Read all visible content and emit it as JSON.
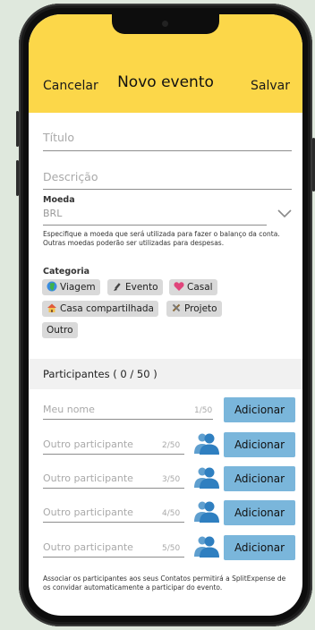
{
  "header": {
    "cancel_label": "Cancelar",
    "title": "Novo evento",
    "save_label": "Salvar",
    "bg_color": "#fcd749"
  },
  "form": {
    "title_placeholder": "Título",
    "description_placeholder": "Descrição",
    "currency_label": "Moeda",
    "currency_value": "BRL",
    "currency_help": "Especifique a moeda que será utilizada para fazer o balanço da conta. Outras moedas poderão ser utilizadas para despesas.",
    "category_label": "Categoria",
    "categories": [
      {
        "label": "Viagem",
        "icon": "globe-icon"
      },
      {
        "label": "Evento",
        "icon": "brush-icon"
      },
      {
        "label": "Casal",
        "icon": "heart-icon"
      },
      {
        "label": "Casa compartilhada",
        "icon": "house-icon"
      },
      {
        "label": "Projeto",
        "icon": "tools-icon"
      },
      {
        "label": "Outro",
        "icon": ""
      }
    ]
  },
  "participants": {
    "section_title": "Participantes ( 0 / 50 )",
    "rows": [
      {
        "placeholder": "Meu nome",
        "count": "1/50",
        "button": "Adicionar",
        "has_contact_icon": false
      },
      {
        "placeholder": "Outro participante",
        "count": "2/50",
        "button": "Adicionar",
        "has_contact_icon": true
      },
      {
        "placeholder": "Outro participante",
        "count": "3/50",
        "button": "Adicionar",
        "has_contact_icon": true
      },
      {
        "placeholder": "Outro participante",
        "count": "4/50",
        "button": "Adicionar",
        "has_contact_icon": true
      },
      {
        "placeholder": "Outro participante",
        "count": "5/50",
        "button": "Adicionar",
        "has_contact_icon": true
      }
    ],
    "button_color": "#7ab6db",
    "footer_note": "Associar os participantes aos seus Contatos permitirá a SplitExpense de os convidar automaticamente a participar do evento."
  }
}
